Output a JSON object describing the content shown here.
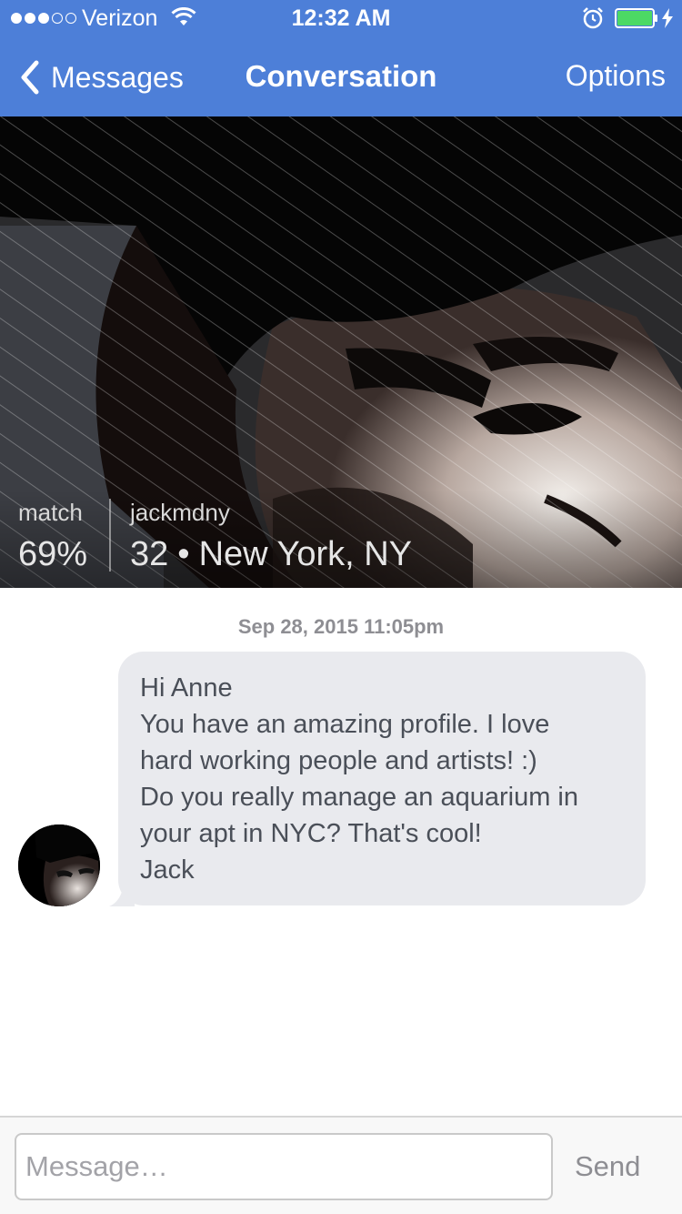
{
  "status_bar": {
    "carrier": "Verizon",
    "signal_bars_filled": 3,
    "signal_bars_total": 5,
    "time": "12:32 AM",
    "battery_level": 1.0,
    "icons": [
      "wifi-icon",
      "alarm-icon",
      "battery-icon",
      "charging-bolt-icon"
    ]
  },
  "nav": {
    "back_label": "Messages",
    "title": "Conversation",
    "options_label": "Options"
  },
  "profile": {
    "match_label": "match",
    "match_value": "69%",
    "username": "jackmdny",
    "age": "32",
    "separator": "•",
    "location": "New York, NY"
  },
  "conversation": {
    "timestamp": "Sep 28, 2015 11:05pm",
    "message_lines": [
      "Hi Anne",
      "You have an amazing profile. I love",
      "hard working people and artists! :)",
      "Do you really manage an aquarium in",
      "your apt in NYC? That's cool!",
      "Jack"
    ]
  },
  "composer": {
    "placeholder": "Message…",
    "value": "",
    "send_label": "Send"
  },
  "colors": {
    "nav_background": "#4d7fd8",
    "bubble_background": "#e9eaee",
    "bubble_text": "#4a4f58",
    "battery_fill": "#4cd964"
  }
}
